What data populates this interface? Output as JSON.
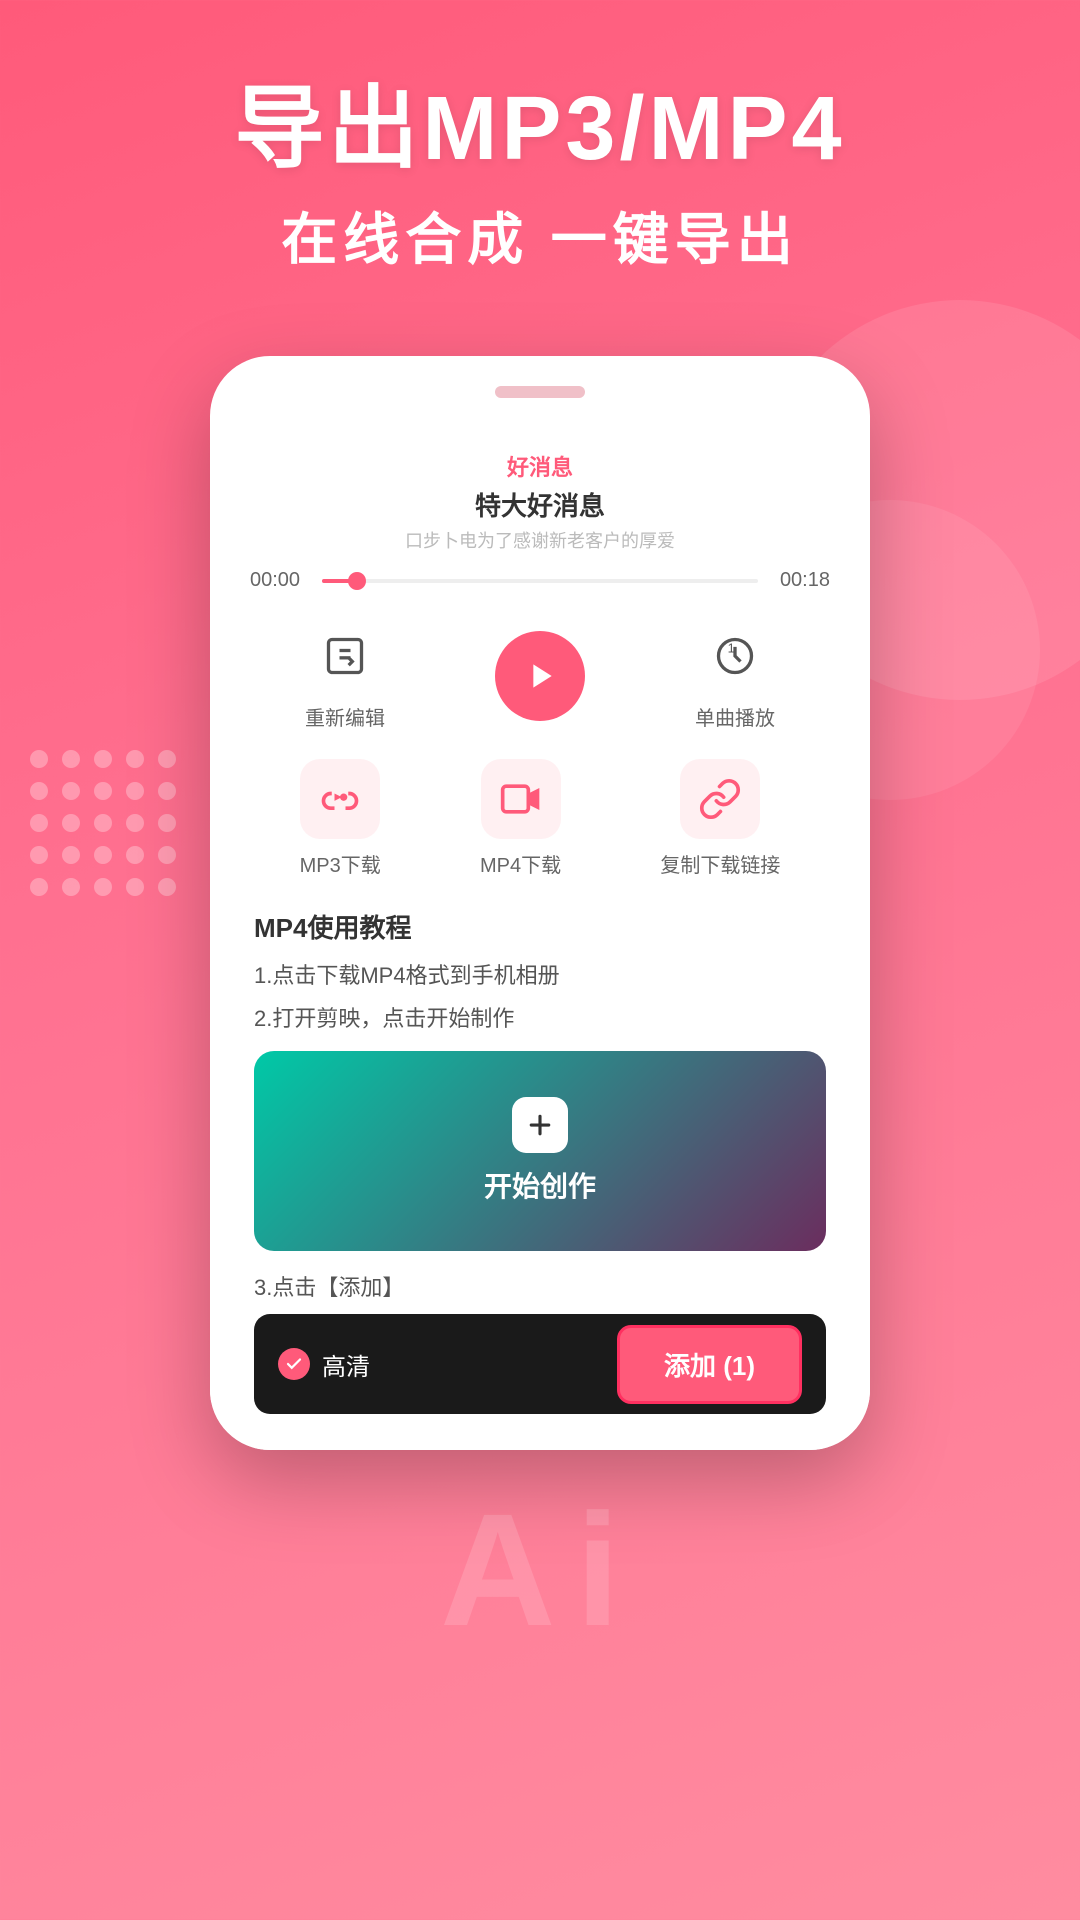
{
  "background": {
    "gradient_start": "#ff5a7a",
    "gradient_end": "#ff8ca0"
  },
  "header": {
    "main_title": "导出MP3/MP4",
    "sub_title": "在线合成 一键导出"
  },
  "audio": {
    "label": "好消息",
    "title_main": "特大好消息",
    "subtitle": "口步卜电为了感谢新老客户的厚爱",
    "time_start": "00:00",
    "time_end": "00:18"
  },
  "controls": {
    "edit_label": "重新编辑",
    "play_label": "",
    "loop_label": "单曲播放"
  },
  "downloads": {
    "mp3_label": "MP3下载",
    "mp4_label": "MP4下载",
    "copy_label": "复制下载链接"
  },
  "tutorial": {
    "title": "MP4使用教程",
    "step1": "1.点击下载MP4格式到手机相册",
    "step2": "2.打开剪映，点击开始制作",
    "creation_text": "开始创作",
    "step3": "3.点击【添加】",
    "hd_text": "高清",
    "add_button_label": "添加 (1)"
  },
  "bottom": {
    "ai_text": "Ai"
  }
}
